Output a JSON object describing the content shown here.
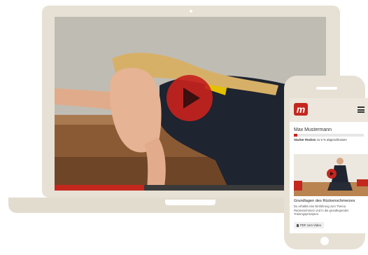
{
  "video": {
    "progress_fraction": 0.33
  },
  "mobile": {
    "logo_letter": "m",
    "user_name": "Max Mustermann",
    "course_progress_fraction": 0.05,
    "course_title": "Starker Rücken",
    "course_status": " zu 5 % abgeschlossen",
    "lesson_title": "Grundlagen des Rückenschmerzes",
    "lesson_description": "Du erhältst eine Einführung zum Thema Rückenschmerz und in die grundlegenden Trainingsprinzipien.",
    "pdf_button_label": "PDF zum Video"
  },
  "colors": {
    "accent": "#c4271e",
    "device_frame": "#e7e1d5"
  }
}
